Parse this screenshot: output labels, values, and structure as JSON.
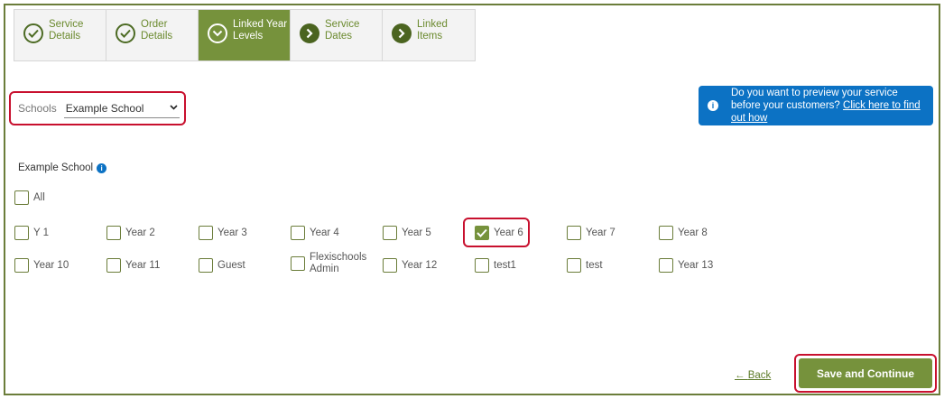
{
  "stepper": {
    "steps": [
      {
        "label_1": "Service",
        "label_2": "Details",
        "icon": "check-circle-icon"
      },
      {
        "label_1": "Order",
        "label_2": "Details",
        "icon": "check-circle-icon"
      },
      {
        "label_1": "Linked Year",
        "label_2": "Levels",
        "icon": "chevron-down-circle-icon"
      },
      {
        "label_1": "Service",
        "label_2": "Dates",
        "icon": "chevron-right-circle-icon"
      },
      {
        "label_1": "Linked",
        "label_2": "Items",
        "icon": "chevron-right-circle-icon"
      }
    ]
  },
  "schools": {
    "label": "Schools",
    "selected": "Example School"
  },
  "banner": {
    "text": "Do you want to preview your service before your customers?",
    "link": "Click here to find out how"
  },
  "school_heading": "Example School",
  "checkboxes": {
    "all": "All",
    "row1": [
      "Y 1",
      "Year 2",
      "Year 3",
      "Year 4",
      "Year 5",
      "Year 6",
      "Year 7",
      "Year 8"
    ],
    "row2": [
      "Year 10",
      "Year 11",
      "Guest",
      "Flexischools",
      "Year 12",
      "test1",
      "test",
      "Year 13"
    ],
    "row2_extra": "Admin",
    "checked": "Year 6"
  },
  "footer": {
    "back": "Back",
    "save": "Save and Continue"
  },
  "colors": {
    "accent": "#76923c",
    "info": "#0c72c4",
    "highlight": "#c8102e"
  }
}
